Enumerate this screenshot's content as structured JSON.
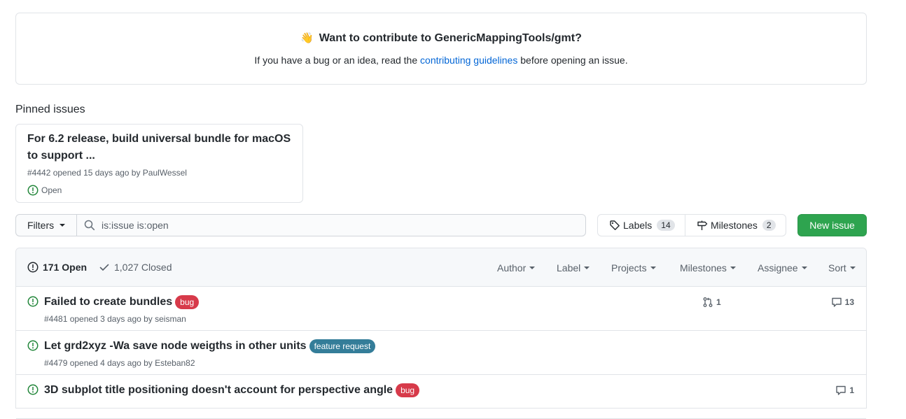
{
  "contribute": {
    "emoji": "👋",
    "title": "Want to contribute to GenericMappingTools/gmt?",
    "text_before": "If you have a bug or an idea, read the ",
    "link": "contributing guidelines",
    "text_after": " before opening an issue."
  },
  "pinned": {
    "heading": "Pinned issues",
    "items": [
      {
        "title": "For 6.2 release, build universal bundle for macOS to support ...",
        "meta": "#4442 opened 15 days ago by PaulWessel",
        "status": "Open"
      }
    ]
  },
  "toolbar": {
    "filters_label": "Filters",
    "search_value": "is:issue is:open",
    "labels_label": "Labels",
    "labels_count": "14",
    "milestones_label": "Milestones",
    "milestones_count": "2",
    "new_issue_label": "New issue"
  },
  "issues_header": {
    "open": "171 Open",
    "closed": "1,027 Closed",
    "filters": [
      "Author",
      "Label",
      "Projects",
      "Milestones",
      "Assignee",
      "Sort"
    ]
  },
  "issues": [
    {
      "title": "Failed to create bundles",
      "label": {
        "name": "bug",
        "color": "#d73a4a"
      },
      "meta": "#4481 opened 3 days ago by seisman",
      "linked_prs": "1",
      "comments": "13"
    },
    {
      "title": "Let grd2xyz -Wa save node weigths in other units",
      "label": {
        "name": "feature request",
        "color": "#347d99"
      },
      "meta": "#4479 opened 4 days ago by Esteban82",
      "linked_prs": "",
      "comments": ""
    },
    {
      "title": "3D subplot title positioning doesn't account for perspective angle",
      "label": {
        "name": "bug",
        "color": "#d73a4a"
      },
      "meta": "",
      "linked_prs": "",
      "comments": "1"
    }
  ],
  "colors": {
    "open_green": "#22863a",
    "primary_button": "#2ea44f",
    "link_blue": "#0366d6"
  }
}
